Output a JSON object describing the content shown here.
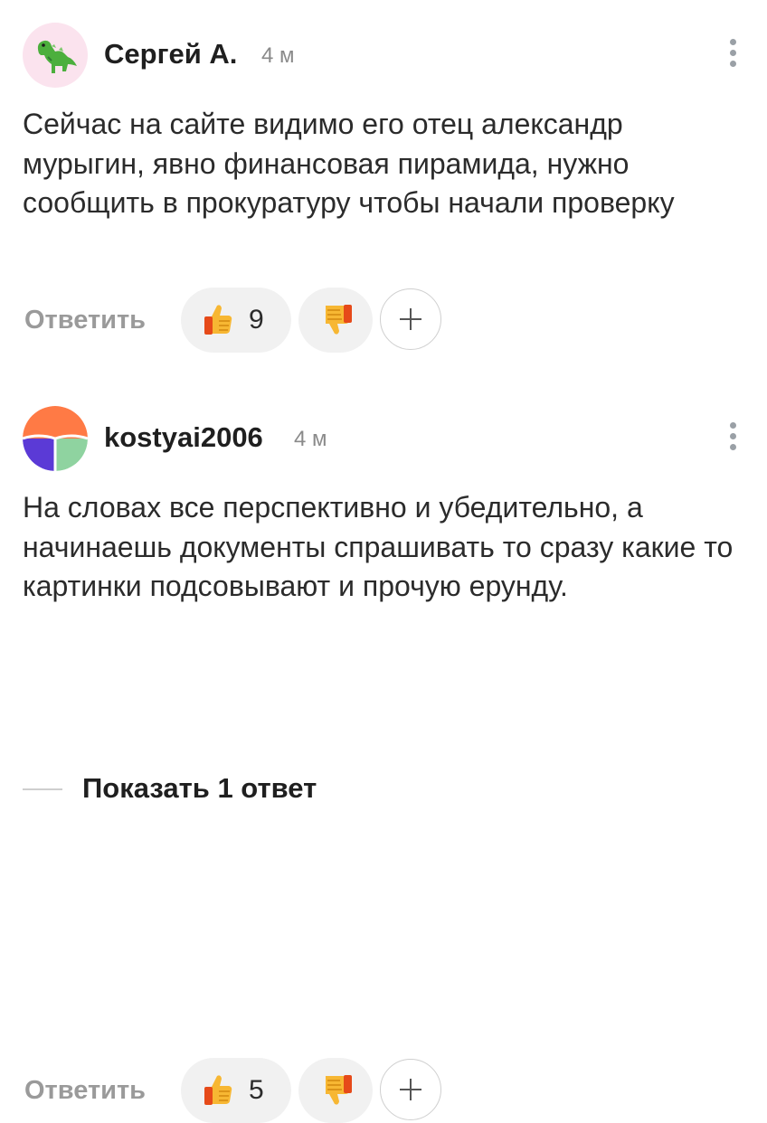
{
  "comments": [
    {
      "author": "Сергей А.",
      "time": "4 м",
      "avatar_icon": "dinosaur-emoji-icon",
      "text": "Сейчас на сайте видимо его отец александр мурыгин, явно финансовая пирамида, нужно сообщить в прокуратуру чтобы начали проверку",
      "reply_label": "Ответить",
      "like_count": "9"
    },
    {
      "author": "kostyai2006",
      "time": "4 м",
      "avatar_icon": "tiles-avatar-icon",
      "text": "На словах все перспективно и убедительно, а начинаешь документы спрашивать то сразу какие то картинки подсовывают и прочую ерунду.",
      "reply_label": "Ответить",
      "like_count": "5"
    }
  ],
  "show_replies": {
    "label": "Показать 1 ответ"
  },
  "colors": {
    "accent_orange": "#ff7a45",
    "accent_purple": "#5b3ad6",
    "accent_green": "#8fd3a0",
    "avatar_pink": "#fbe3ee"
  }
}
